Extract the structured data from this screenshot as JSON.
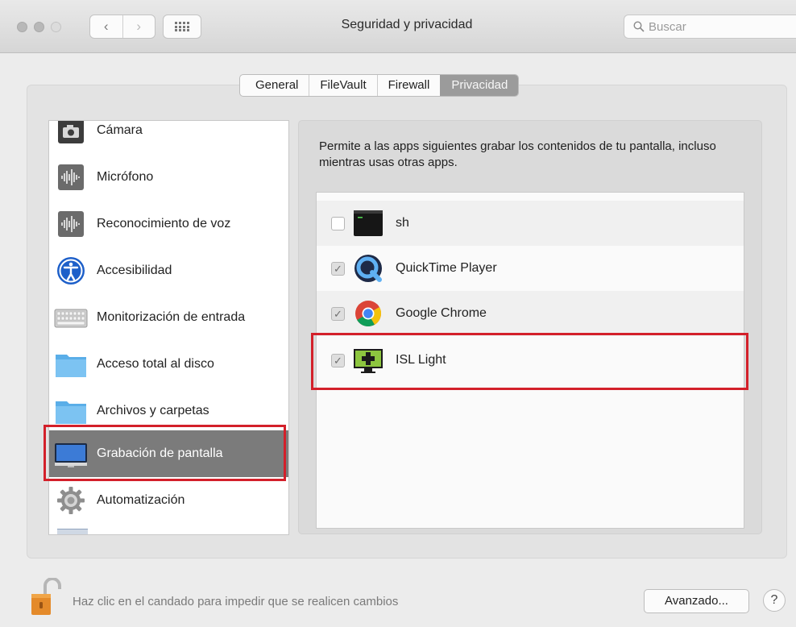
{
  "window": {
    "title": "Seguridad y privacidad",
    "back_glyph": "‹",
    "forward_glyph": "›",
    "search_placeholder": "Buscar"
  },
  "tabs": [
    {
      "label": "General",
      "active": false
    },
    {
      "label": "FileVault",
      "active": false
    },
    {
      "label": "Firewall",
      "active": false
    },
    {
      "label": "Privacidad",
      "active": true
    }
  ],
  "categories": [
    {
      "label": "Cámara",
      "icon": "camera-icon"
    },
    {
      "label": "Micrófono",
      "icon": "microphone-icon"
    },
    {
      "label": "Reconocimiento de voz",
      "icon": "speech-recognition-icon"
    },
    {
      "label": "Accesibilidad",
      "icon": "accessibility-icon"
    },
    {
      "label": "Monitorización de entrada",
      "icon": "keyboard-icon"
    },
    {
      "label": "Acceso total al disco",
      "icon": "folder-icon"
    },
    {
      "label": "Archivos y carpetas",
      "icon": "folder-icon"
    },
    {
      "label": "Grabación de pantalla",
      "icon": "display-icon",
      "selected": true
    },
    {
      "label": "Automatización",
      "icon": "gear-icon"
    }
  ],
  "main": {
    "description": "Permite a las apps siguientes grabar los contenidos de tu pantalla, incluso mientras usas otras apps.",
    "apps": [
      {
        "name": "sh",
        "checked": false,
        "icon": "terminal-icon"
      },
      {
        "name": "QuickTime Player",
        "checked": true,
        "icon": "quicktime-icon"
      },
      {
        "name": "Google Chrome",
        "checked": true,
        "icon": "chrome-icon"
      },
      {
        "name": "ISL Light",
        "checked": true,
        "icon": "isl-light-icon"
      }
    ]
  },
  "footer": {
    "lock_text": "Haz clic en el candado para impedir que se realicen cambios",
    "advanced_label": "Avanzado...",
    "help_label": "?"
  },
  "colors": {
    "selection_gray": "#7b7b7b",
    "highlight_red": "#d3202a",
    "active_tab": "#9b9b9b"
  }
}
